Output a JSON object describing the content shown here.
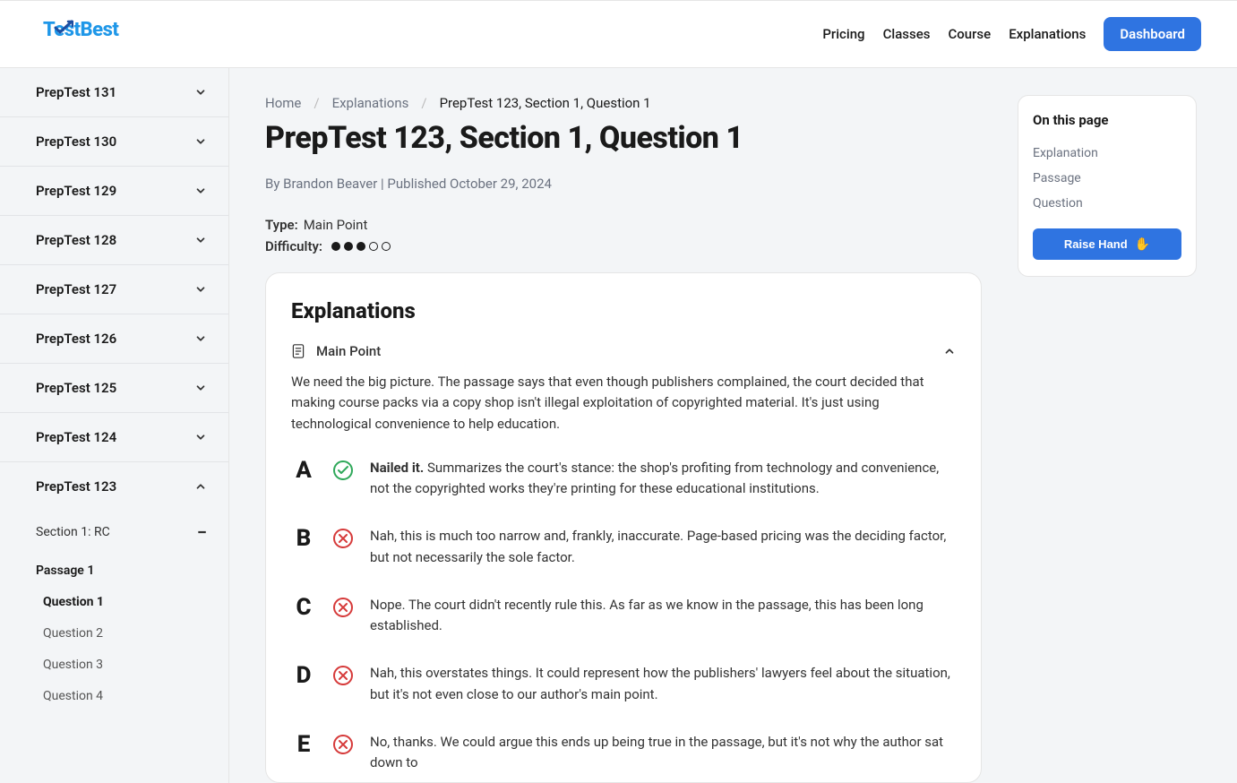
{
  "logo": {
    "text1": "Test",
    "text2": "Best"
  },
  "nav": {
    "links": [
      "Pricing",
      "Classes",
      "Course",
      "Explanations"
    ],
    "dashboard": "Dashboard"
  },
  "sidebar": {
    "tests": [
      {
        "label": "PrepTest 131",
        "expanded": false
      },
      {
        "label": "PrepTest 130",
        "expanded": false
      },
      {
        "label": "PrepTest 129",
        "expanded": false
      },
      {
        "label": "PrepTest 128",
        "expanded": false
      },
      {
        "label": "PrepTest 127",
        "expanded": false
      },
      {
        "label": "PrepTest 126",
        "expanded": false
      },
      {
        "label": "PrepTest 125",
        "expanded": false
      },
      {
        "label": "PrepTest 124",
        "expanded": false
      },
      {
        "label": "PrepTest 123",
        "expanded": true
      }
    ],
    "section": "Section 1: RC",
    "passage": "Passage 1",
    "questions": [
      {
        "label": "Question 1",
        "active": true
      },
      {
        "label": "Question 2",
        "active": false
      },
      {
        "label": "Question 3",
        "active": false
      },
      {
        "label": "Question 4",
        "active": false
      }
    ]
  },
  "breadcrumb": {
    "home": "Home",
    "explanations": "Explanations",
    "current": "PrepTest 123, Section 1, Question 1"
  },
  "page_title": "PrepTest 123, Section 1, Question 1",
  "byline": "By Brandon Beaver | Published October 29, 2024",
  "meta": {
    "type_label": "Type:",
    "type_value": "Main Point",
    "difficulty_label": "Difficulty:",
    "difficulty_filled": 3,
    "difficulty_total": 5
  },
  "card": {
    "heading": "Explanations",
    "accordion_title": "Main Point",
    "body": "We need the big picture. The passage says that even though publishers complained, the court decided that making course packs via a copy shop isn't illegal exploitation of copyrighted material. It's just using technological convenience to help education.",
    "choices": [
      {
        "letter": "A",
        "status": "correct",
        "lead": "Nailed it.",
        "text": " Summarizes the court's stance: the shop's profiting from technology and convenience, not the copyrighted works they're printing for these educational institutions."
      },
      {
        "letter": "B",
        "status": "wrong",
        "lead": "",
        "text": "Nah, this is much too narrow and, frankly, inaccurate. Page-based pricing was the deciding factor, but not necessarily the sole factor."
      },
      {
        "letter": "C",
        "status": "wrong",
        "lead": "",
        "text": "Nope. The court didn't recently rule this. As far as we know in the passage, this has been long established."
      },
      {
        "letter": "D",
        "status": "wrong",
        "lead": "",
        "text": "Nah, this overstates things. It could represent how the publishers' lawyers feel about the situation, but it's not even close to our author's main point."
      },
      {
        "letter": "E",
        "status": "wrong",
        "lead": "",
        "text": "No, thanks. We could argue this ends up being true in the passage, but it's not why the author sat down to"
      }
    ]
  },
  "rail": {
    "heading": "On this page",
    "links": [
      "Explanation",
      "Passage",
      "Question"
    ],
    "raise_button": "Raise Hand"
  }
}
